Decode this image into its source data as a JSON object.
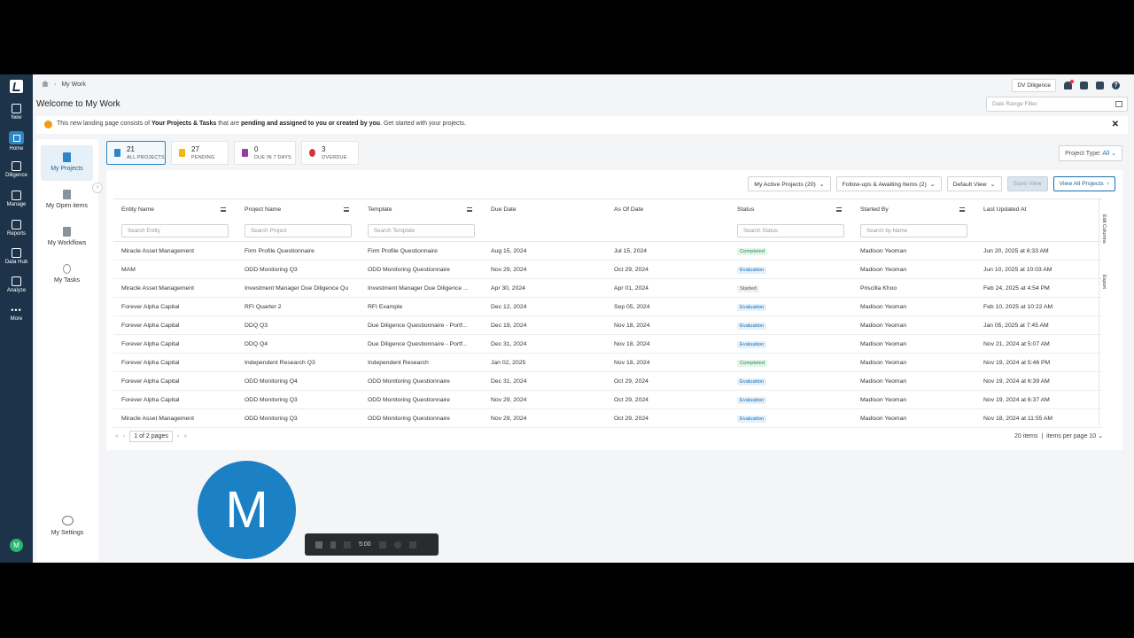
{
  "rail": [
    {
      "label": "New",
      "icon": "plus-square-icon"
    },
    {
      "label": "Home",
      "icon": "home-icon",
      "active": true
    },
    {
      "label": "Diligence",
      "icon": "diligence-icon"
    },
    {
      "label": "Manage",
      "icon": "manage-icon"
    },
    {
      "label": "Reports",
      "icon": "reports-icon"
    },
    {
      "label": "Data Hub",
      "icon": "data-hub-icon"
    },
    {
      "label": "Analyze",
      "icon": "analyze-icon"
    },
    {
      "label": "More",
      "icon": "more-dots-icon"
    }
  ],
  "user_initial": "M",
  "breadcrumb": {
    "current": "My Work"
  },
  "top": {
    "org": "DV Diligence"
  },
  "page_title": "Welcome to My Work",
  "date_filter_placeholder": "Date Range Filter",
  "banner": {
    "pre": "This new landing page consists of ",
    "bold1": "Your Projects & Tasks",
    "mid": " that are ",
    "bold2": "pending and assigned to you or created by you",
    "post": ". Get started with your projects."
  },
  "subnav": {
    "projects": "My Projects",
    "open_items": "My Open items",
    "workflows": "My Workflows",
    "tasks": "My Tasks",
    "settings": "My Settings"
  },
  "kpis": [
    {
      "value": "21",
      "label": "ALL PROJECTS",
      "color": "#2d86c4"
    },
    {
      "value": "27",
      "label": "PENDING",
      "color": "#f1b80e"
    },
    {
      "value": "0",
      "label": "DUE IN 7 DAYS",
      "color": "#9b3aa8"
    },
    {
      "value": "3",
      "label": "OVERDUE",
      "color": "#d8323c"
    }
  ],
  "project_type": {
    "label": "Project Type:",
    "value": "All"
  },
  "toolbar": {
    "active_projects": "My Active Projects (20)",
    "followups": "Follow-ups & Awaiting Items (2)",
    "default_view": "Default View",
    "save_view": "Save View",
    "view_all": "View All Projects"
  },
  "columns": [
    "Entity Name",
    "Project Name",
    "Template",
    "Due Date",
    "As Of Date",
    "Status",
    "Started By",
    "Last Updated At"
  ],
  "filters": {
    "entity": "Search Entity",
    "project": "Search Project",
    "template": "Search Template",
    "status": "Search Status",
    "name": "Search by Name"
  },
  "rows": [
    {
      "entity": "Miracle Asset Management",
      "project": "Firm Profile Questionnaire",
      "template": "Firm Profile Questionnaire",
      "due": "Aug 15, 2024",
      "asof": "Jul 15, 2024",
      "status": "Completed",
      "started": "Madison Yeoman",
      "updated": "Jun 20, 2025 at 6:33 AM"
    },
    {
      "entity": "MAM",
      "project": "ODD Monitoring Q3",
      "template": "ODD Monitoring Questionnaire",
      "due": "Nov 29, 2024",
      "asof": "Oct 29, 2024",
      "status": "Evaluation",
      "started": "Madison Yeoman",
      "updated": "Jun 10, 2025 at 10:03 AM"
    },
    {
      "entity": "Miracle Asset Management",
      "project": "Investment Manager Due Diligence Qu",
      "template": "Investment Manager Due Diligence ...",
      "due": "Apr 30, 2024",
      "asof": "Apr 01, 2024",
      "status": "Started",
      "started": "Priscilla Khoo",
      "updated": "Feb 24, 2025 at 4:54 PM"
    },
    {
      "entity": "Forever Alpha Capital",
      "project": "RFI Quarter 2",
      "template": "RFI Example",
      "due": "Dec 12, 2024",
      "asof": "Sep 05, 2024",
      "status": "Evaluation",
      "started": "Madison Yeoman",
      "updated": "Feb 10, 2025 at 10:22 AM"
    },
    {
      "entity": "Forever Alpha Capital",
      "project": "DDQ Q3",
      "template": "Due Diligence Questionnaire - Portf...",
      "due": "Dec 19, 2024",
      "asof": "Nov 18, 2024",
      "status": "Evaluation",
      "started": "Madison Yeoman",
      "updated": "Jan 05, 2025 at 7:45 AM"
    },
    {
      "entity": "Forever Alpha Capital",
      "project": "DDQ Q4",
      "template": "Due Diligence Questionnaire - Portf...",
      "due": "Dec 31, 2024",
      "asof": "Nov 18, 2024",
      "status": "Evaluation",
      "started": "Madison Yeoman",
      "updated": "Nov 21, 2024 at 5:07 AM"
    },
    {
      "entity": "Forever Alpha Capital",
      "project": "Independent Research Q3",
      "template": "Independent Research",
      "due": "Jan 02, 2025",
      "asof": "Nov 18, 2024",
      "status": "Completed",
      "started": "Madison Yeoman",
      "updated": "Nov 19, 2024 at 5:46 PM"
    },
    {
      "entity": "Forever Alpha Capital",
      "project": "ODD Monitoring Q4",
      "template": "ODD Monitoring Questionnaire",
      "due": "Dec 31, 2024",
      "asof": "Oct 29, 2024",
      "status": "Evaluation",
      "started": "Madison Yeoman",
      "updated": "Nov 19, 2024 at 6:39 AM"
    },
    {
      "entity": "Forever Alpha Capital",
      "project": "ODD Monitoring Q3",
      "template": "ODD Monitoring Questionnaire",
      "due": "Nov 29, 2024",
      "asof": "Oct 29, 2024",
      "status": "Evaluation",
      "started": "Madison Yeoman",
      "updated": "Nov 19, 2024 at 6:37 AM"
    },
    {
      "entity": "Miracle Asset Management",
      "project": "ODD Monitoring Q3",
      "template": "ODD Monitoring Questionnaire",
      "due": "Nov 29, 2024",
      "asof": "Oct 29, 2024",
      "status": "Evaluation",
      "started": "Madison Yeoman",
      "updated": "Nov 18, 2024 at 11:55 AM"
    }
  ],
  "side_strip": {
    "edit_columns": "Edit Columns",
    "export": "Export"
  },
  "pager": {
    "page": "1",
    "of": "of",
    "total": "2",
    "pages": "pages"
  },
  "items_info": {
    "count": "20 items",
    "per_page_label": "items per page",
    "per_page": "10"
  },
  "overlay": {
    "avatar_letter": "M",
    "timer": "5:00"
  }
}
